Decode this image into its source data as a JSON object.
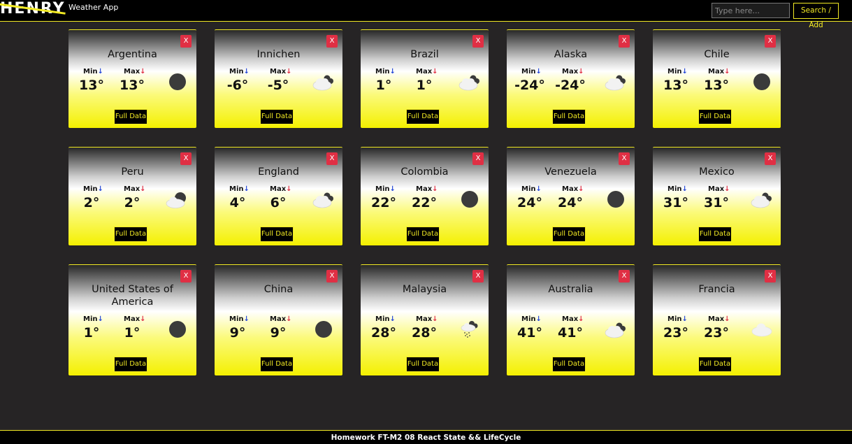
{
  "navbar": {
    "logo": "HENRY",
    "app_title": "Weather App",
    "search_placeholder": "Type here...",
    "search_button": "Search / Add"
  },
  "card_labels": {
    "min": "Min",
    "max": "Max",
    "min_arrow": "↓",
    "max_arrow": "↓",
    "close": "X",
    "full_data": "Full Data"
  },
  "cities": [
    {
      "name": "Argentina",
      "min": "13°",
      "max": "13°",
      "icon": "moon-icon"
    },
    {
      "name": "Innichen",
      "min": "-6°",
      "max": "-5°",
      "icon": "cloudy-icon"
    },
    {
      "name": "Brazil",
      "min": "1°",
      "max": "1°",
      "icon": "cloudy-icon"
    },
    {
      "name": "Alaska",
      "min": "-24°",
      "max": "-24°",
      "icon": "cloudy-icon"
    },
    {
      "name": "Chile",
      "min": "13°",
      "max": "13°",
      "icon": "moon-icon"
    },
    {
      "name": "Peru",
      "min": "2°",
      "max": "2°",
      "icon": "partly-cloudy-night-icon"
    },
    {
      "name": "England",
      "min": "4°",
      "max": "6°",
      "icon": "cloudy-icon"
    },
    {
      "name": "Colombia",
      "min": "22°",
      "max": "22°",
      "icon": "moon-icon"
    },
    {
      "name": "Venezuela",
      "min": "24°",
      "max": "24°",
      "icon": "moon-icon"
    },
    {
      "name": "Mexico",
      "min": "31°",
      "max": "31°",
      "icon": "cloudy-icon"
    },
    {
      "name": "United States of America",
      "min": "1°",
      "max": "1°",
      "icon": "moon-icon"
    },
    {
      "name": "China",
      "min": "9°",
      "max": "9°",
      "icon": "moon-icon"
    },
    {
      "name": "Malaysia",
      "min": "28°",
      "max": "28°",
      "icon": "rain-icon"
    },
    {
      "name": "Australia",
      "min": "41°",
      "max": "41°",
      "icon": "cloudy-icon"
    },
    {
      "name": "Francia",
      "min": "23°",
      "max": "23°",
      "icon": "cloud-icon"
    }
  ],
  "footer": {
    "text": "Homework FT-M2 08 React State && LifeCycle"
  },
  "colors": {
    "accent": "#f2ea24",
    "close": "#e02f44",
    "background": "#262425",
    "min_arrow": "#2548d8",
    "max_arrow": "#e02f44"
  }
}
